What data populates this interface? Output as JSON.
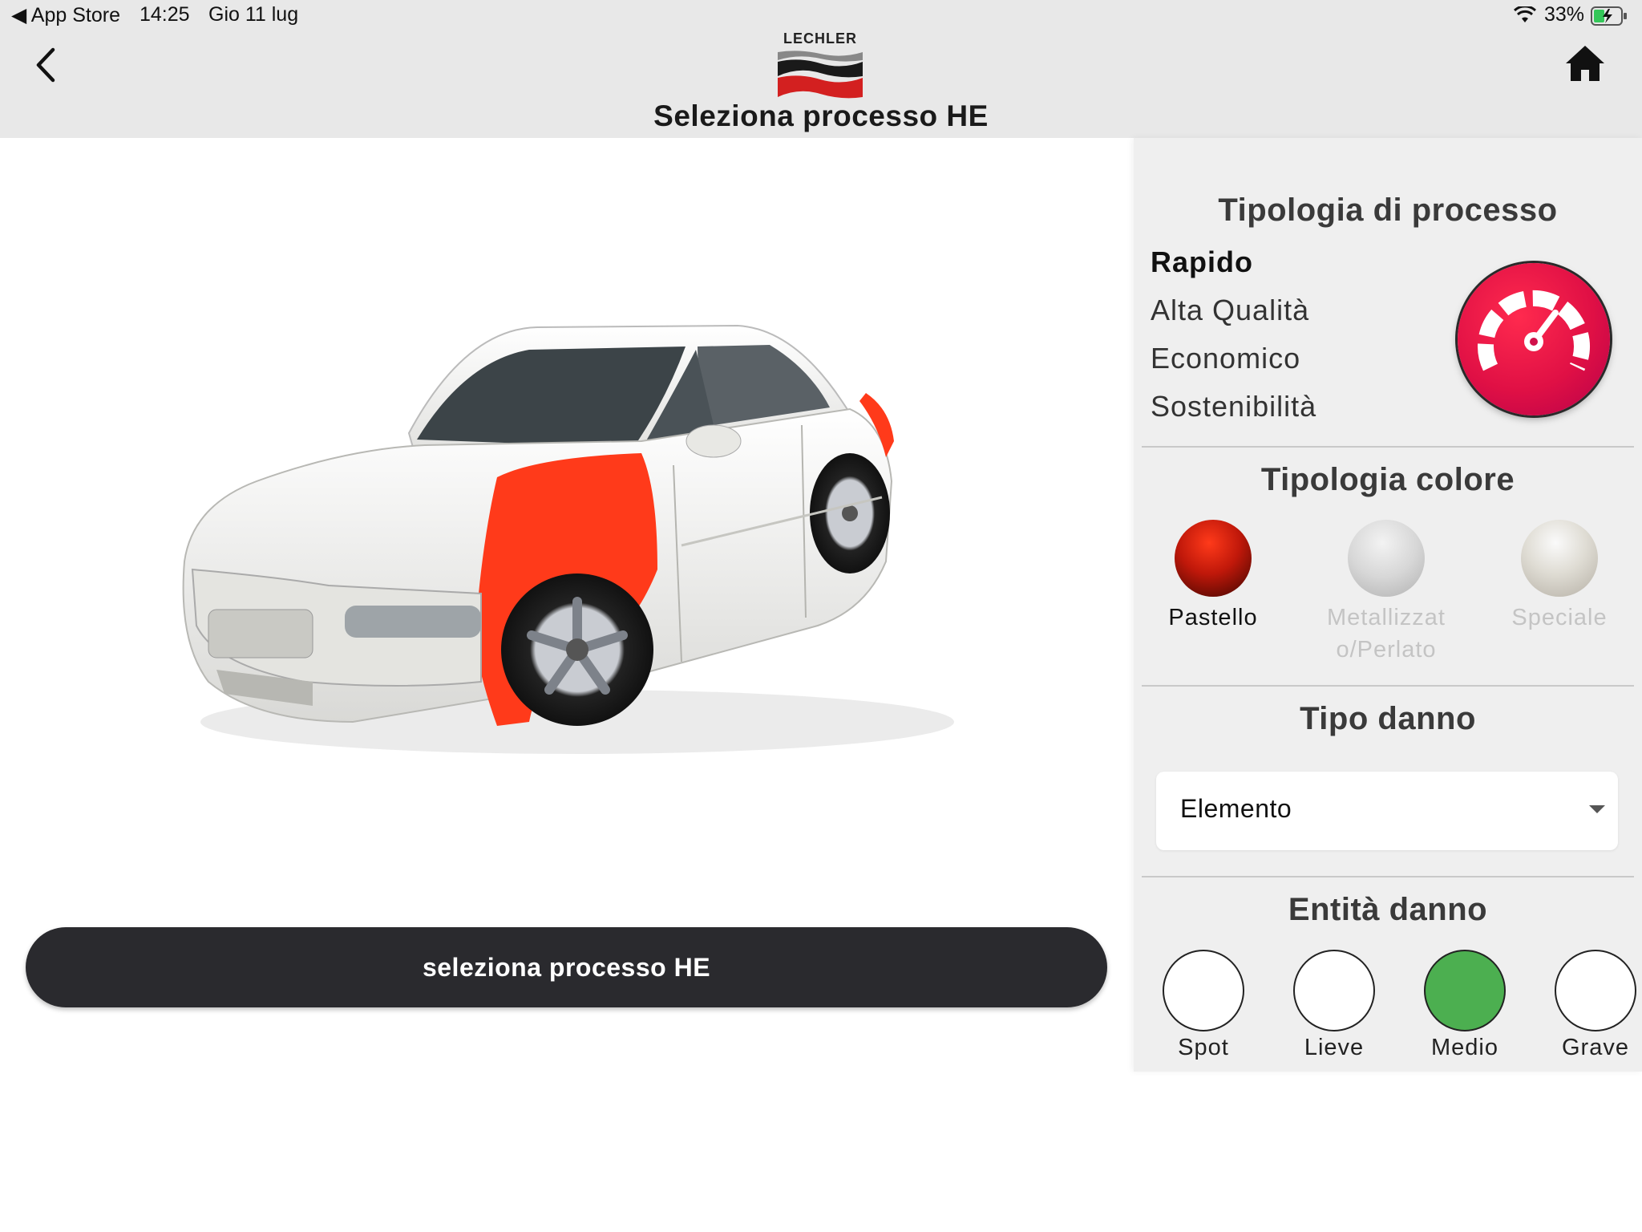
{
  "status_bar": {
    "back_app": "◀ App Store",
    "time": "14:25",
    "date": "Gio 11 lug",
    "battery": "33%"
  },
  "header": {
    "brand": "LECHLER",
    "title": "Seleziona processo HE"
  },
  "main": {
    "button_label": "seleziona processo HE"
  },
  "panel": {
    "process_title": "Tipologia di processo",
    "process_items": [
      "Rapido",
      "Alta Qualità",
      "Economico",
      "Sostenibilità"
    ],
    "selected_process": "Rapido",
    "color_title": "Tipologia colore",
    "colors": [
      {
        "line1": "Pastello",
        "line2": ""
      },
      {
        "line1": "Metallizzat",
        "line2": "o/Perlato"
      },
      {
        "line1": "Speciale",
        "line2": ""
      }
    ],
    "damage_type_title": "Tipo danno",
    "damage_type_value": "Elemento",
    "severity_title": "Entità danno",
    "severity": [
      "Spot",
      "Lieve",
      "Medio",
      "Grave"
    ],
    "selected_severity": "Medio"
  },
  "colors": {
    "accent_red": "#e01045",
    "selected_green": "#4caf50",
    "button_dark": "#2a2a2e",
    "highlight_panel": "#ff3a1a"
  }
}
